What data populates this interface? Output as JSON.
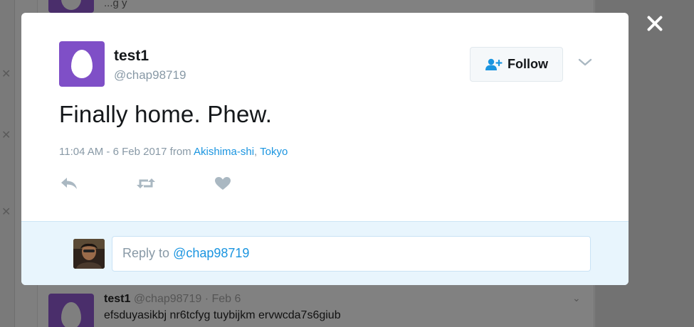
{
  "background": {
    "top_partial_text": "...g y",
    "tweet": {
      "name": "test1",
      "handle": "@chap98719",
      "date": "Feb 6",
      "separator": "·",
      "text": "efsduyasikbj nr6tcfyg tuybijkm ervwcda7s6giub"
    }
  },
  "modal": {
    "author": {
      "name": "test1",
      "handle": "@chap98719"
    },
    "follow_button": {
      "label": "Follow",
      "icon": "add-user-icon"
    },
    "tweet_text": "Finally home. Phew.",
    "meta": {
      "timestamp": "11:04 AM - 6 Feb 2017",
      "from_label": "from",
      "location_city": "Akishima-shi",
      "location_sep": ",",
      "location_region": "Tokyo"
    },
    "actions": [
      "reply-icon",
      "retweet-icon",
      "like-icon"
    ],
    "reply": {
      "placeholder_prefix": "Reply to",
      "placeholder_mention": "@chap98719"
    }
  },
  "colors": {
    "accent": "#1b95e0",
    "avatar_purple": "#7f4fc7",
    "reply_bg": "#e8f5fd",
    "icon_gray": "#aab8c2"
  }
}
